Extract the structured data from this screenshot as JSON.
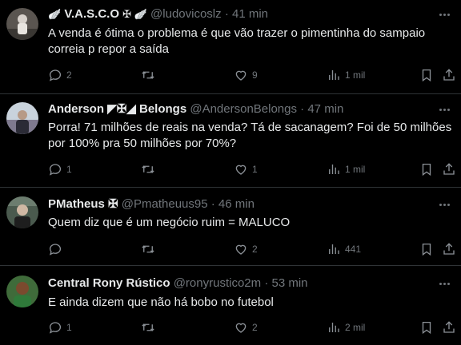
{
  "tweets": [
    {
      "name": "V.A.S.C.O",
      "emoji_before": "🪽",
      "emoji_after": "✠ 🪽",
      "handle": "@ludovicoslz",
      "time": "41 min",
      "text": "A venda é ótima o problema é que vão trazer o pimentinha do sampaio correia p repor a saída",
      "replies": "2",
      "retweets": "",
      "likes": "9",
      "views": "1 mil"
    },
    {
      "name": "Anderson",
      "emoji_before": "",
      "emoji_after": "◤✠◢ Belongs",
      "handle": "@AndersonBelongs",
      "time": "47 min",
      "text": "Porra! 71 milhões de reais na venda? Tá de sacanagem? Foi de 50 milhões por 100% pra 50 milhões por 70%?",
      "replies": "1",
      "retweets": "",
      "likes": "1",
      "views": "1 mil"
    },
    {
      "name": "PMatheus",
      "emoji_before": "",
      "emoji_after": "✠",
      "handle": "@Pmatheuus95",
      "time": "46 min",
      "text": "Quem diz que é um negócio ruim = MALUCO",
      "replies": "",
      "retweets": "",
      "likes": "2",
      "views": "441"
    },
    {
      "name": "Central Rony Rústico",
      "emoji_before": "",
      "emoji_after": "",
      "handle": "@ronyrustico2m",
      "time": "53 min",
      "text": "E ainda dizem que não há bobo no futebol",
      "replies": "1",
      "retweets": "",
      "likes": "2",
      "views": "2 mil"
    }
  ],
  "separator": "·",
  "colors": {
    "background": "#000000",
    "text": "#e7e9ea",
    "muted": "#71767b",
    "border": "#2f3336"
  },
  "icons": [
    "reply-icon",
    "retweet-icon",
    "like-icon",
    "views-icon",
    "bookmark-icon",
    "share-icon",
    "more-icon"
  ]
}
